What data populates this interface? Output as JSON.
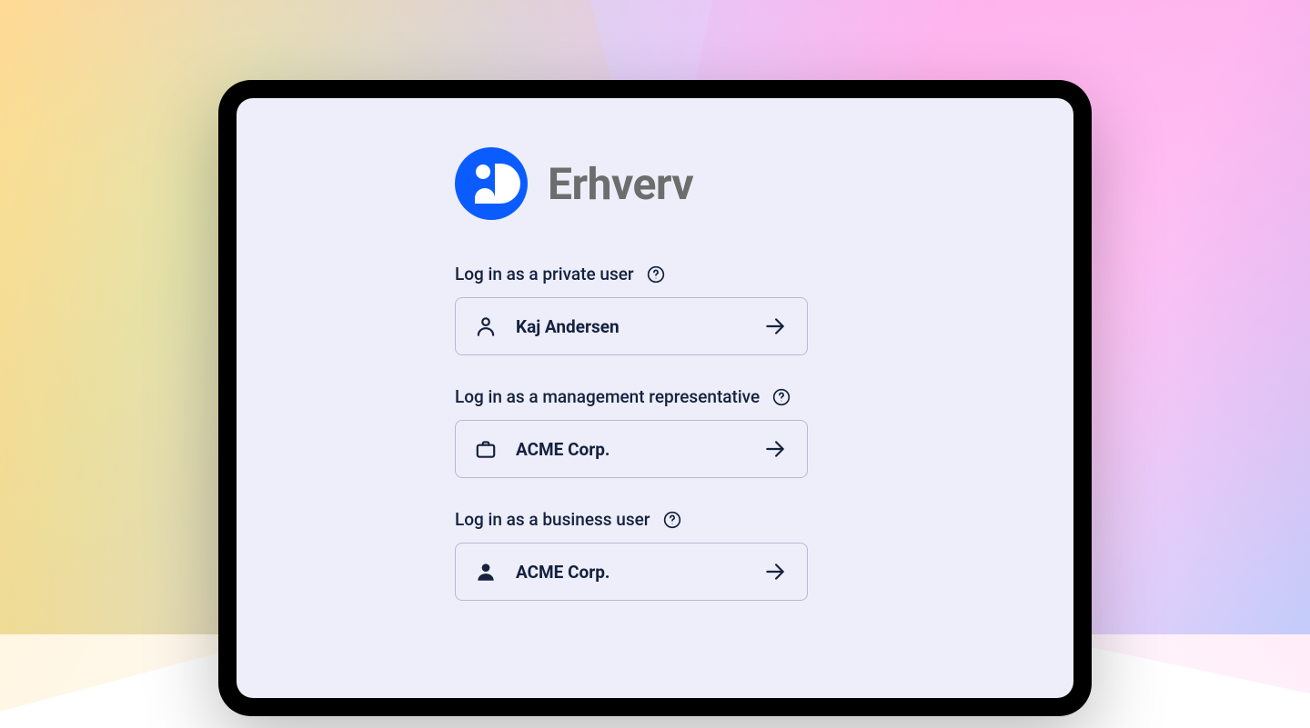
{
  "brand": {
    "title": "Erhverv",
    "logo_name": "mitid-logo",
    "logo_color": "#0b5cff"
  },
  "sections": [
    {
      "label": "Log in as a private user",
      "option": {
        "name": "Kaj Andersen",
        "icon": "person-outline-icon"
      }
    },
    {
      "label": "Log in as a management representative",
      "option": {
        "name": "ACME Corp.",
        "icon": "briefcase-icon"
      }
    },
    {
      "label": "Log in as a business user",
      "option": {
        "name": "ACME Corp.",
        "icon": "person-solid-icon"
      }
    }
  ]
}
